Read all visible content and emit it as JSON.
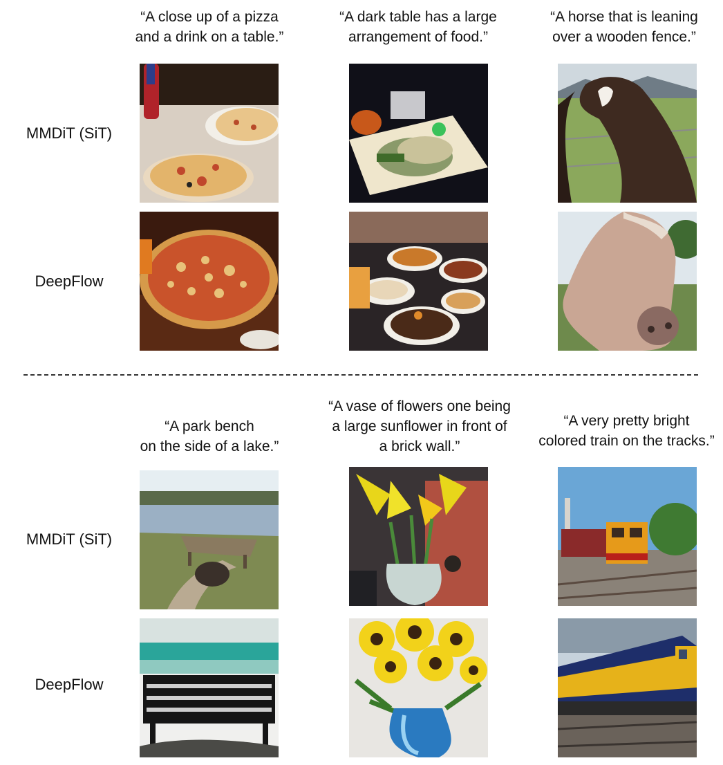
{
  "sections": [
    {
      "captions": [
        [
          "“A close up of a pizza",
          "and a drink on a table.”"
        ],
        [
          "“A dark table has a large",
          "arrangement of food.”"
        ],
        [
          "“A horse that is leaning",
          "over a wooden fence.”"
        ]
      ],
      "rows": [
        {
          "label": "MMDiT (SiT)"
        },
        {
          "label": "DeepFlow"
        }
      ]
    },
    {
      "captions": [
        [
          "“A park bench",
          "on the side of a lake.”"
        ],
        [
          "“A vase of flowers one being",
          "a large sunflower in front of",
          "a brick wall.”"
        ],
        [
          "“A very pretty bright",
          "colored train on the tracks.”"
        ]
      ],
      "rows": [
        {
          "label": "MMDiT (SiT)"
        },
        {
          "label": "DeepFlow"
        }
      ]
    }
  ]
}
